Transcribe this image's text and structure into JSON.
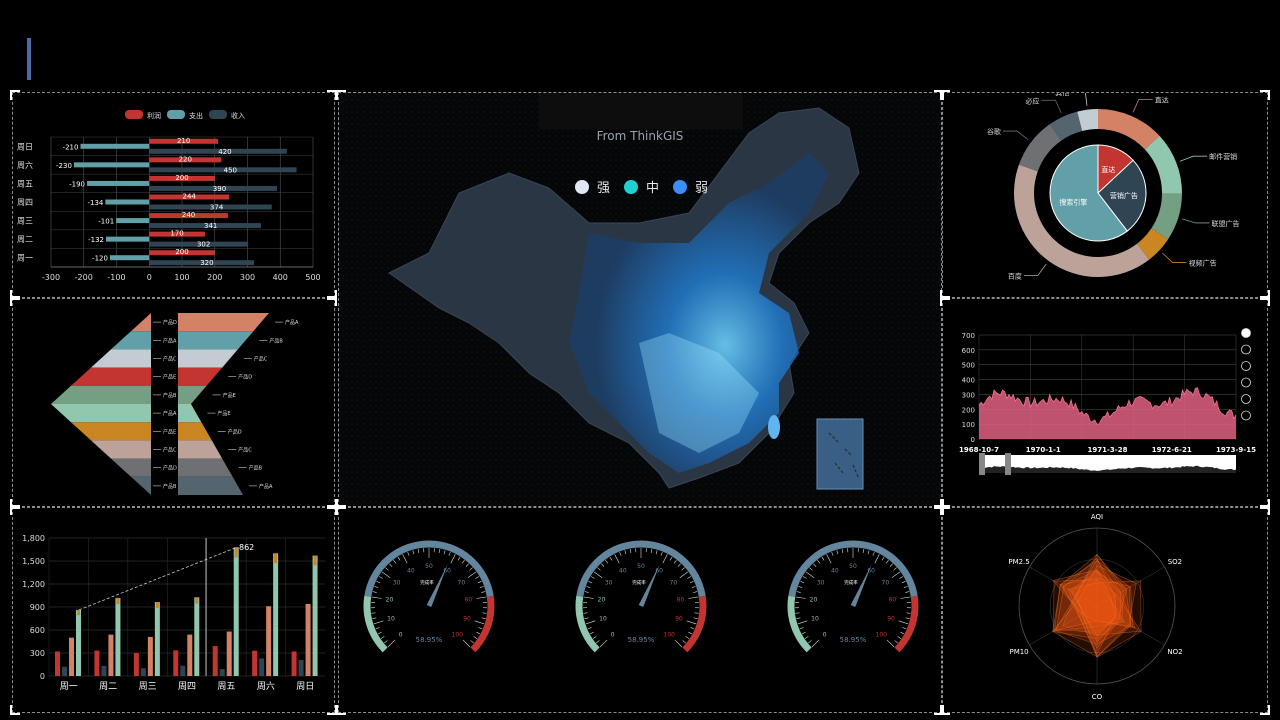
{
  "header": {
    "accent_color": "#4a6da8"
  },
  "bar_chart": {
    "legend": [
      "利润",
      "支出",
      "收入"
    ],
    "colors": [
      "#c23531",
      "#61a0a8",
      "#2f4554"
    ],
    "categories": [
      "周一",
      "周二",
      "周三",
      "周四",
      "周五",
      "周六",
      "周日"
    ],
    "profit": [
      200,
      170,
      240,
      244,
      200,
      220,
      210
    ],
    "expense": [
      -120,
      -132,
      -101,
      -134,
      -190,
      -230,
      -210
    ],
    "income": [
      320,
      302,
      341,
      374,
      390,
      450,
      420
    ],
    "x_ticks": [
      "-300",
      "-200",
      "-100",
      "0",
      "100",
      "200",
      "300",
      "400",
      "500"
    ]
  },
  "funnel": {
    "left_labels": [
      "产品D",
      "产品A",
      "产品C",
      "产品E",
      "产品B",
      "产品A",
      "产品E",
      "产品C",
      "产品D",
      "产品B"
    ],
    "right_labels": [
      "产品A",
      "产品B",
      "产品C",
      "产品D",
      "产品E",
      "产品E",
      "产品D",
      "产品C",
      "产品B",
      "产品A"
    ],
    "colors": [
      "#d48265",
      "#61a0a8",
      "#c4ccd3",
      "#c23531",
      "#749f83",
      "#91c7ae",
      "#ca8622",
      "#bda29a",
      "#6e7074",
      "#546570"
    ]
  },
  "map": {
    "subtitle": "From ThinkGIS",
    "legend": [
      {
        "label": "强",
        "color": "#e0e6f3"
      },
      {
        "label": "中",
        "color": "#20d0d0"
      },
      {
        "label": "弱",
        "color": "#3a8ef5"
      }
    ]
  },
  "pie": {
    "inner": [
      {
        "name": "直达",
        "value": 335,
        "color": "#c23531"
      },
      {
        "name": "营销广告",
        "value": 679,
        "color": "#2f4554"
      },
      {
        "name": "搜索引擎",
        "value": 1548,
        "color": "#61a0a8"
      }
    ],
    "outer": [
      {
        "name": "直达",
        "value": 335,
        "color": "#d48265"
      },
      {
        "name": "邮件营销",
        "value": 310,
        "color": "#91c7ae"
      },
      {
        "name": "联盟广告",
        "value": 234,
        "color": "#749f83"
      },
      {
        "name": "视频广告",
        "value": 135,
        "color": "#ca8622"
      },
      {
        "name": "百度",
        "value": 1048,
        "color": "#bda29a"
      },
      {
        "name": "谷歌",
        "value": 251,
        "color": "#6e7074"
      },
      {
        "name": "必应",
        "value": 147,
        "color": "#546570"
      },
      {
        "name": "其他",
        "value": 102,
        "color": "#c4ccd3"
      }
    ]
  },
  "area": {
    "y_ticks": [
      "0",
      "100",
      "200",
      "300",
      "400",
      "500",
      "600",
      "700"
    ],
    "x_ticks": [
      "1968-10-7",
      "1970-1-1",
      "1971-3-28",
      "1972-6-21",
      "1973-9-15"
    ],
    "color": "#e06080",
    "toggles": 6
  },
  "column_chart": {
    "categories": [
      "周一",
      "周二",
      "周三",
      "周四",
      "周五",
      "周六",
      "周日"
    ],
    "y_ticks": [
      "0",
      "300",
      "600",
      "900",
      "1,200",
      "1,500",
      "1,800"
    ],
    "annotation": "862",
    "series": [
      {
        "name": "s1",
        "color": "#c23531",
        "values": [
          320,
          332,
          301,
          334,
          390,
          330,
          320
        ]
      },
      {
        "name": "s2",
        "color": "#2f4554",
        "values": [
          120,
          132,
          101,
          134,
          90,
          230,
          210
        ]
      },
      {
        "name": "s3",
        "color": "#d48265",
        "values": [
          500,
          540,
          510,
          540,
          580,
          910,
          940
        ]
      },
      {
        "name": "s4",
        "color": "#91c7ae",
        "values": [
          862,
          1018,
          964,
          1026,
          1679,
          1600,
          1570
        ]
      }
    ]
  },
  "gauges": [
    {
      "value_text": "58.95%",
      "name": "完成率",
      "value": 58.95
    },
    {
      "value_text": "58.95%",
      "name": "完成率",
      "value": 58.95
    },
    {
      "value_text": "58.95%",
      "name": "完成率",
      "value": 58.95
    }
  ],
  "gauge_ticks": [
    "0",
    "10",
    "20",
    "30",
    "40",
    "50",
    "60",
    "70",
    "80",
    "90",
    "100"
  ],
  "radar": {
    "indicators": [
      "AQI",
      "SO2",
      "NO2",
      "CO",
      "PM10",
      "PM2.5"
    ]
  }
}
